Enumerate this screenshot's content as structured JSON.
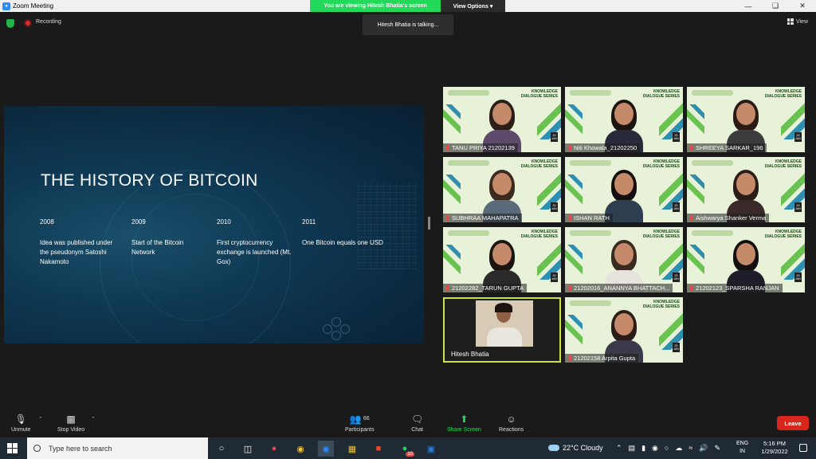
{
  "window": {
    "title": "Zoom Meeting",
    "viewing_banner": "You are viewing Hitesh Bhatia's screen",
    "view_options": "View Options ▾"
  },
  "meeting": {
    "recording_label": "Recording",
    "talking": "Hitesh Bhatia is talking...",
    "view_label": "View"
  },
  "slide": {
    "title": "THE HISTORY OF BITCOIN",
    "timeline": [
      {
        "year": "2008",
        "text": "Idea was published under the pseudonym Satoshi Nakamoto"
      },
      {
        "year": "2009",
        "text": "Start of the Bitcoin Network"
      },
      {
        "year": "2010",
        "text": "First cryptocurrency exchange is launched (Mt. Gox)"
      },
      {
        "year": "2011",
        "text": "One Bitcoin equals one USD"
      }
    ]
  },
  "tiles": {
    "brand_text": "KNOWLEDGE DIALOGUE SERIES",
    "badge": "29 JAN",
    "participants": [
      {
        "name": "TANU PRIYA 21202139"
      },
      {
        "name": "Niti Khowala_21202250"
      },
      {
        "name": "SHREEYA SARKAR_196"
      },
      {
        "name": "SUBHRAA MAHAPATRA"
      },
      {
        "name": "ISHAN RATH"
      },
      {
        "name": "Aishwarya Shanker Verma"
      },
      {
        "name": "21202282_TARUN GUPTA"
      },
      {
        "name": "21202016_ANANNYA BHATTACH..."
      },
      {
        "name": "21202123_SPARSHA RANJAN"
      },
      {
        "name": "Hitesh Bhatia"
      },
      {
        "name": "21202158 Arpita Gupta"
      }
    ]
  },
  "toolbar": {
    "unmute": "Unmute",
    "stop_video": "Stop Video",
    "participants": "Participants",
    "participants_count": "66",
    "chat": "Chat",
    "share_screen": "Share Screen",
    "reactions": "Reactions",
    "leave": "Leave"
  },
  "taskbar": {
    "search_placeholder": "Type here to search",
    "weather": "22°C Cloudy",
    "lang_line1": "ENG",
    "lang_line2": "IN",
    "time": "5:16 PM",
    "date": "1/29/2022",
    "whatsapp_badge": "10"
  },
  "colors": {
    "zoom_green": "#23d959",
    "leave_red": "#d9261c",
    "active_speaker": "#c8e63a"
  }
}
